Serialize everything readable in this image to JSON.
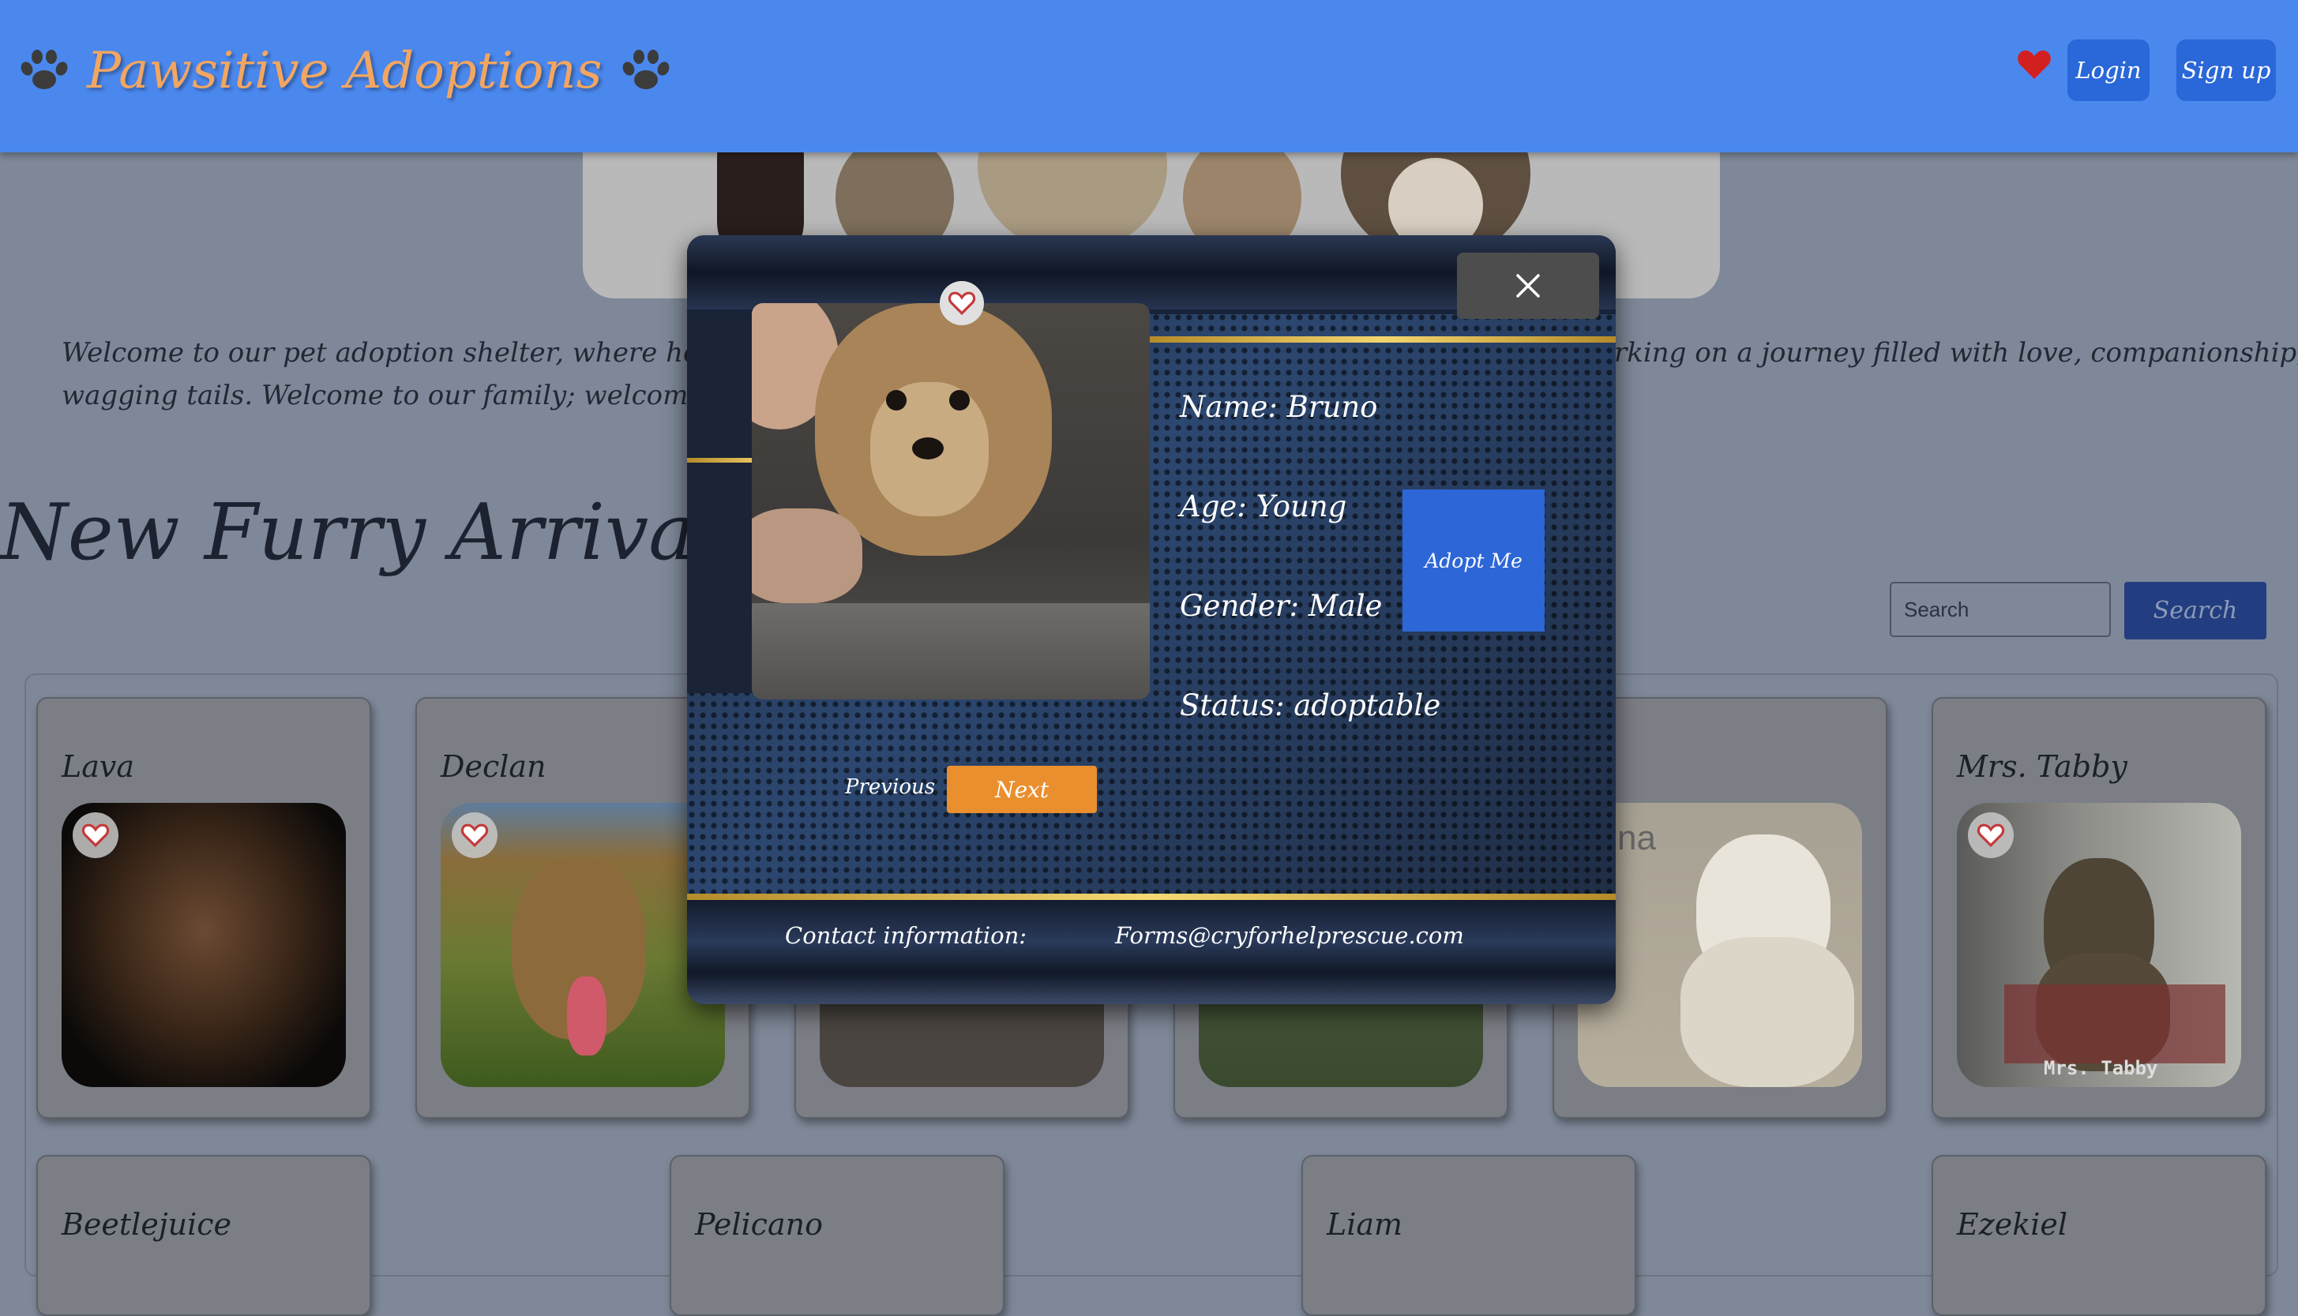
{
  "header": {
    "brand": "Pawsitive Adoptions",
    "login_label": "Login",
    "signup_label": "Sign up",
    "favorites_icon": "heart-icon",
    "paw_icon": "paw-icon",
    "background_color": "#4b88ee"
  },
  "welcome": {
    "line1_start": "Welcome to our pet adoption shelter, where hearts are u",
    "line1_end": "rking on a journey filled with love, companionship, and",
    "line2": "wagging tails. Welcome to our family; welcome to a worl"
  },
  "section": {
    "title": "New Furry Arrivals"
  },
  "search": {
    "placeholder": "Search",
    "button_label": "Search"
  },
  "pets_row1": [
    {
      "name": "Lava"
    },
    {
      "name": "Declan"
    },
    {
      "name": ""
    },
    {
      "name": ""
    },
    {
      "name": "na"
    },
    {
      "name": "Mrs. Tabby"
    }
  ],
  "pets_row2": [
    {
      "name": "Beetlejuice"
    },
    {
      "name": "Pelicano"
    },
    {
      "name": "Liam"
    },
    {
      "name": "Ezekiel"
    }
  ],
  "photo_overlays": {
    "card5_text": "na",
    "card6_caption": "Mrs. Tabby"
  },
  "modal": {
    "name": "Name: Bruno",
    "age": "Age: Young",
    "gender": "Gender: Male",
    "status": "Status: adoptable",
    "adopt_label": "Adopt Me",
    "previous_label": "Previous",
    "next_label": "Next",
    "contact_label": "Contact information:",
    "contact_email": "Forms@cryforhelprescue.com",
    "close_icon": "close-icon"
  },
  "colors": {
    "brand_orange": "#f2a661",
    "primary_blue": "#2a67d8",
    "next_orange": "#e98f2e",
    "heart_red": "#d22020"
  }
}
